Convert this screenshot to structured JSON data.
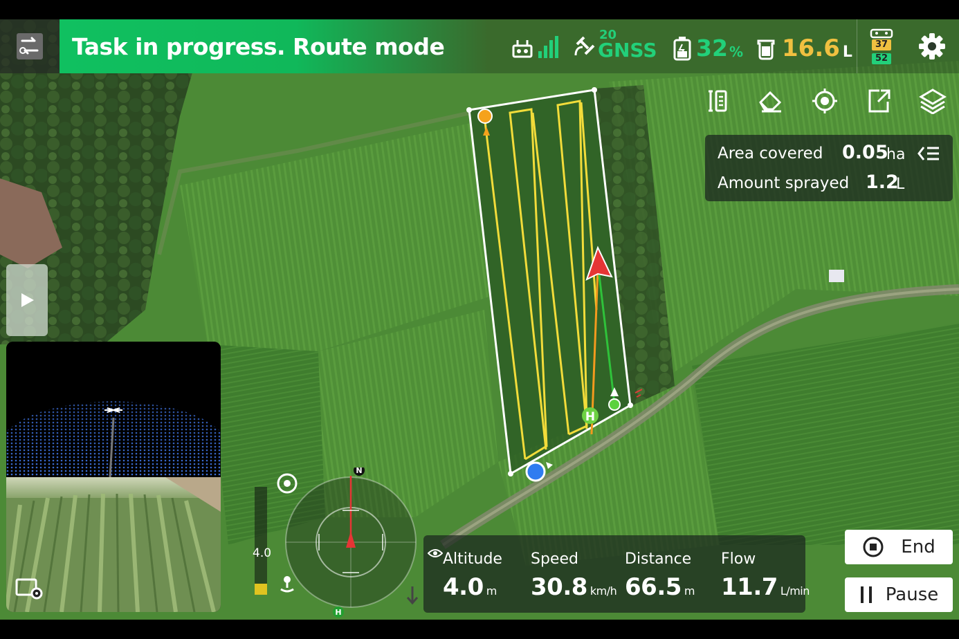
{
  "header": {
    "status": "Task in progress. Route mode",
    "gnss_count": "20",
    "gnss_label": "GNSS",
    "battery_value": "32",
    "battery_unit": "%",
    "tank_value": "16.6",
    "tank_unit": "L",
    "rc_battery_top": "37",
    "rc_battery_bottom": "52"
  },
  "toolbar": {
    "icons": [
      "route-edit-icon",
      "eraser-icon",
      "locate-icon",
      "export-icon",
      "layers-icon"
    ]
  },
  "info": {
    "area_label": "Area covered",
    "area_value": "0.05",
    "area_unit": "ha",
    "sprayed_label": "Amount sprayed",
    "sprayed_value": "1.2",
    "sprayed_unit": "L"
  },
  "altitude_gauge": {
    "value_label": "4.0"
  },
  "compass": {
    "north": "N",
    "home": "H"
  },
  "map_markers": {
    "home": "H"
  },
  "stats": {
    "altitude_label": "Altitude",
    "altitude_value": "4.0",
    "altitude_unit": "m",
    "speed_label": "Speed",
    "speed_value": "30.8",
    "speed_unit": "km/h",
    "distance_label": "Distance",
    "distance_value": "66.5",
    "distance_unit": "m",
    "flow_label": "Flow",
    "flow_value": "11.7",
    "flow_unit": "L/min"
  },
  "actions": {
    "end_label": "End",
    "pause_label": "Pause"
  },
  "colors": {
    "status_green": "#10c060",
    "accent_green": "#22d07a",
    "tank_yellow": "#f0c040",
    "route_yellow": "#f2dc3a",
    "boundary": "#ffffff"
  }
}
